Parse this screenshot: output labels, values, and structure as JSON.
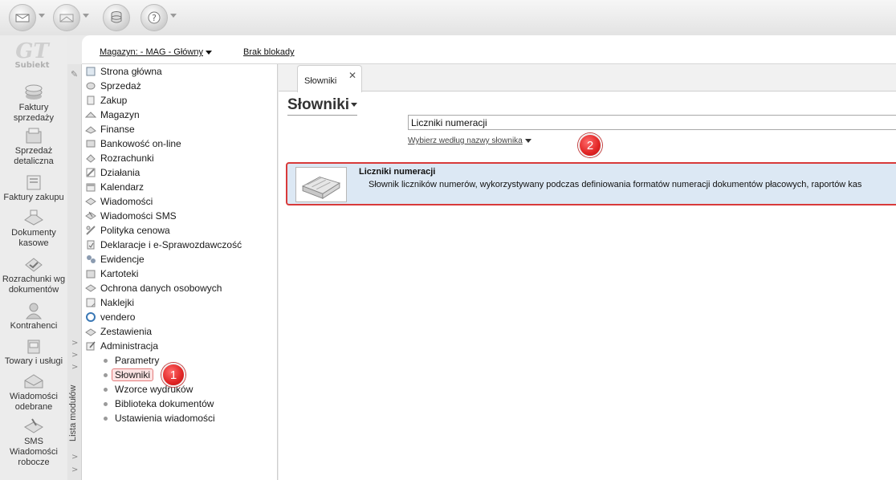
{
  "toolbar": {
    "buttons": [
      {
        "icon": "send-envelope-icon"
      },
      {
        "icon": "receive-envelope-icon"
      },
      {
        "icon": "database-coins-icon"
      },
      {
        "icon": "help-question-icon"
      }
    ]
  },
  "sidebar": {
    "logo_text": "Subiekt",
    "items": [
      {
        "label": "Faktury sprzedaży",
        "icon": "invoice-sales-icon"
      },
      {
        "label": "Sprzedaż detaliczna",
        "icon": "retail-sale-icon"
      },
      {
        "label": "Faktury zakupu",
        "icon": "invoice-purchase-icon"
      },
      {
        "label": "Dokumenty kasowe",
        "icon": "cash-documents-icon"
      },
      {
        "label": "Rozrachunki wg dokumentów",
        "icon": "settlements-icon"
      },
      {
        "label": "Kontrahenci",
        "icon": "contractors-icon"
      },
      {
        "label": "Towary i usługi",
        "icon": "goods-services-icon"
      },
      {
        "label": "Wiadomości odebrane",
        "icon": "messages-received-icon"
      },
      {
        "label": "SMS Wiadomości robocze",
        "icon": "sms-drafts-icon"
      }
    ]
  },
  "modules_panel": {
    "label": "Lista modułów"
  },
  "infobar": {
    "warehouse": "Magazyn: - MAG - Główny",
    "lock_status": "Brak blokady"
  },
  "tree": {
    "items": [
      {
        "label": "Strona główna",
        "icon": "home-icon"
      },
      {
        "label": "Sprzedaż",
        "icon": "sales-icon"
      },
      {
        "label": "Zakup",
        "icon": "purchase-icon"
      },
      {
        "label": "Magazyn",
        "icon": "warehouse-icon"
      },
      {
        "label": "Finanse",
        "icon": "finance-icon"
      },
      {
        "label": "Bankowość on-line",
        "icon": "online-banking-icon"
      },
      {
        "label": "Rozrachunki",
        "icon": "settlements-icon"
      },
      {
        "label": "Działania",
        "icon": "actions-icon"
      },
      {
        "label": "Kalendarz",
        "icon": "calendar-icon"
      },
      {
        "label": "Wiadomości",
        "icon": "messages-icon"
      },
      {
        "label": "Wiadomości SMS",
        "icon": "sms-icon"
      },
      {
        "label": "Polityka cenowa",
        "icon": "price-policy-icon"
      },
      {
        "label": "Deklaracje i e-Sprawozdawczość",
        "icon": "declarations-icon"
      },
      {
        "label": "Ewidencje",
        "icon": "records-icon"
      },
      {
        "label": "Kartoteki",
        "icon": "files-icon"
      },
      {
        "label": "Ochrona danych osobowych",
        "icon": "data-protection-icon"
      },
      {
        "label": "Naklejki",
        "icon": "stickers-icon"
      },
      {
        "label": "vendero",
        "icon": "vendero-icon"
      },
      {
        "label": "Zestawienia",
        "icon": "reports-icon"
      },
      {
        "label": "Administracja",
        "icon": "administration-icon"
      }
    ],
    "subitems": [
      {
        "label": "Parametry"
      },
      {
        "label": "Słowniki"
      },
      {
        "label": "Wzorce wydruków"
      },
      {
        "label": "Biblioteka dokumentów"
      },
      {
        "label": "Ustawienia wiadomości"
      }
    ]
  },
  "callouts": {
    "first": "1",
    "second": "2"
  },
  "main": {
    "tab_label": "Słowniki",
    "close_glyph": "✕",
    "title": "Słowniki",
    "search_value": "Liczniki numeracji",
    "filter_label": "Wybierz według nazwy słownika",
    "result": {
      "title": "Liczniki numeracji",
      "description": "Słownik liczników numerów, wykorzystywany podczas definiowania formatów numeracji dokumentów płacowych, raportów kas"
    }
  },
  "colors": {
    "accent_red": "#d83a3a",
    "selection_blue": "#dce8f4"
  }
}
